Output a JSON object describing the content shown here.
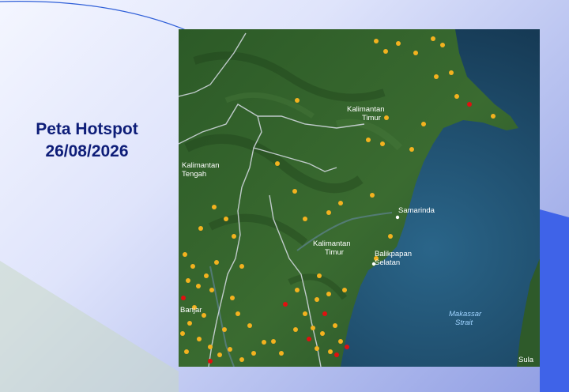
{
  "slide": {
    "title_line1": "Peta Hotspot",
    "title_line2": "26/08/2026"
  },
  "colors": {
    "title": "#0d1d78",
    "hotspot_low": "#f3b21f",
    "hotspot_high": "#e01010",
    "sea": "#1f4f6e",
    "land": "#2f5d2a"
  },
  "map": {
    "labels": {
      "region_kaltim_north_1": "Kalimantan",
      "region_kaltim_north_2": "Timur",
      "region_kalteng_1": "Kalimantan",
      "region_kalteng_2": "Tengah",
      "region_kaltim_south_1": "Kalimantan",
      "region_kaltim_south_2": "Timur",
      "city_samarinda": "Samarinda",
      "city_balikpapan_1": "Balikpapan",
      "city_balikpapan_2": "Selatan",
      "region_banjar": "Banjar",
      "sea_makassar_1": "Makassar",
      "sea_makassar_2": "Strait",
      "corner_sula": "Sula"
    }
  }
}
